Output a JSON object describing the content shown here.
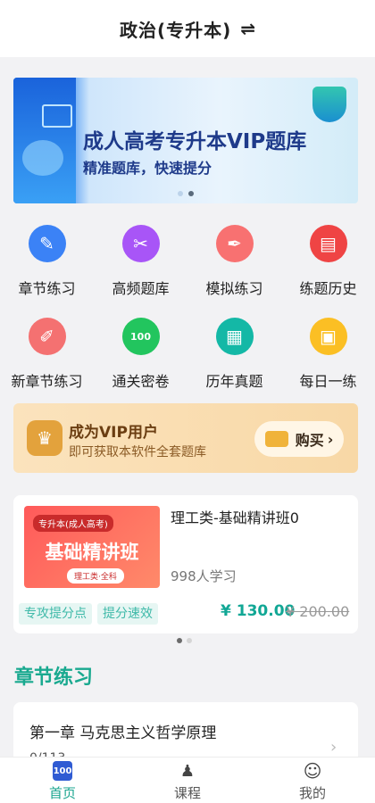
{
  "header": {
    "title": "政治(专升本)",
    "switch_icon": "⇌"
  },
  "banner": {
    "headline": "成人高考专升本VIP题库",
    "subline": "精准题库，快速提分",
    "pages": 2,
    "active_page": 2
  },
  "menu": [
    {
      "label": "章节练习",
      "icon": "pen-icon",
      "glyph": "✎",
      "color": "#3b82f6"
    },
    {
      "label": "高频题库",
      "icon": "tools-icon",
      "glyph": "✂",
      "color": "#a855f7"
    },
    {
      "label": "模拟练习",
      "icon": "fountain-pen-icon",
      "glyph": "✒",
      "color": "#f87171"
    },
    {
      "label": "练题历史",
      "icon": "notebook-icon",
      "glyph": "▤",
      "color": "#ef4444"
    },
    {
      "label": "新章节练习",
      "icon": "pen-nib-icon",
      "glyph": "✐",
      "color": "#f47171"
    },
    {
      "label": "通关密卷",
      "icon": "exam-paper-icon",
      "glyph": "100",
      "color": "#22c55e"
    },
    {
      "label": "历年真题",
      "icon": "document-icon",
      "glyph": "▦",
      "color": "#14b8a6"
    },
    {
      "label": "每日一练",
      "icon": "calendar-icon",
      "glyph": "▣",
      "color": "#fbbf24"
    }
  ],
  "vip": {
    "title": "成为VIP用户",
    "subtitle": "即可获取本软件全套题库",
    "buy_label": "购买",
    "buy_chevron": "›"
  },
  "course": {
    "thumb_tag": "专升本(成人高考)",
    "thumb_title": "基础精讲班",
    "thumb_pill": "理工类·全科",
    "name": "理工类-基础精讲班0",
    "learners": "998人学习",
    "tags": [
      "专攻提分点",
      "提分速效"
    ],
    "price": "¥ 130.00",
    "original_price": "¥ 200.00",
    "pages": 2,
    "active_page": 1
  },
  "section": {
    "title": "章节练习"
  },
  "chapter": {
    "title": "第一章  马克思主义哲学原理",
    "progress": "0/113",
    "chevron": "›"
  },
  "tabs": [
    {
      "label": "首页",
      "icon": "home-exam-icon",
      "glyph": "100",
      "active": true
    },
    {
      "label": "课程",
      "icon": "lecturer-icon",
      "glyph": "♟",
      "active": false
    },
    {
      "label": "我的",
      "icon": "user-icon",
      "glyph": "☺",
      "active": false
    }
  ]
}
